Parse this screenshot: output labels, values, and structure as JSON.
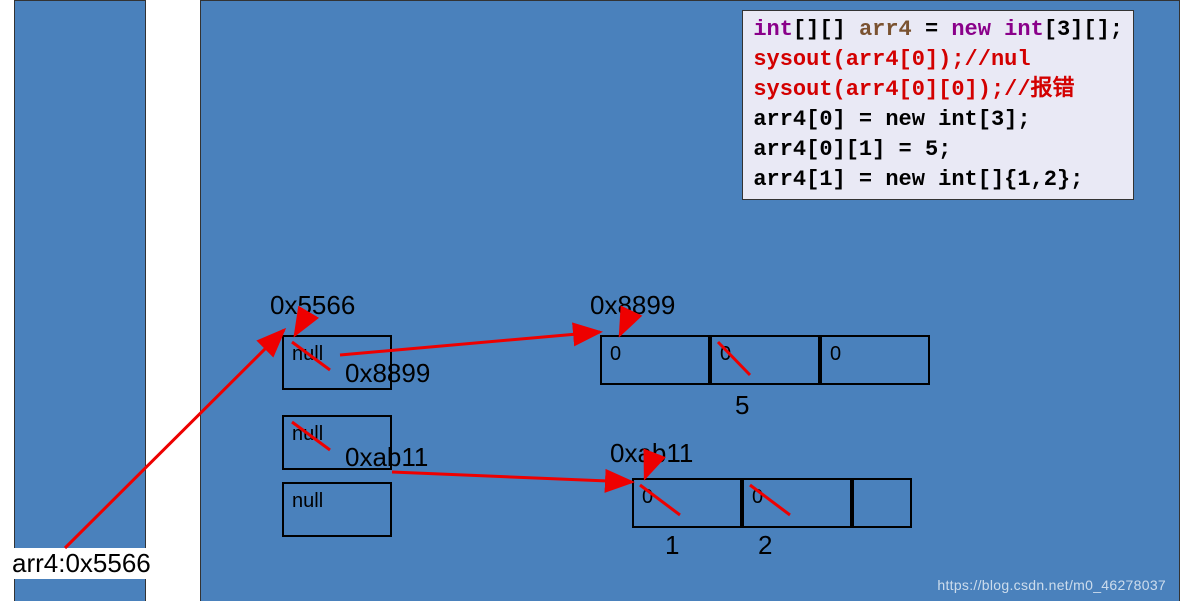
{
  "stack_label": "arr4:0x5566",
  "addr_arr4": "0x5566",
  "addr_row0": "0x8899",
  "addr_row1": "0xab11",
  "arr4_cells": [
    "null",
    "null",
    "null"
  ],
  "arr4_overwrite0": "0x8899",
  "arr4_overwrite1": "0xab11",
  "row0_cells": [
    "0",
    "0",
    "0"
  ],
  "row0_overwrite": "5",
  "row1_cells": [
    "0",
    "0"
  ],
  "row1_overwrite0": "1",
  "row1_overwrite1": "2",
  "code": {
    "l1_kw1": "int",
    "l1_txt1": "[][] ",
    "l1_var": "arr4",
    "l1_txt2": " = ",
    "l1_kw2": "new int",
    "l1_txt3": "[3][];",
    "l2": "sysout(arr4[0]);//nul",
    "l3": "sysout(arr4[0][0]);//报错",
    "l4": "arr4[0] = new int[3];",
    "l5": "arr4[0][1] = 5;",
    "l6": "arr4[1] = new int[]{1,2};"
  },
  "watermark": "https://blog.csdn.net/m0_46278037"
}
